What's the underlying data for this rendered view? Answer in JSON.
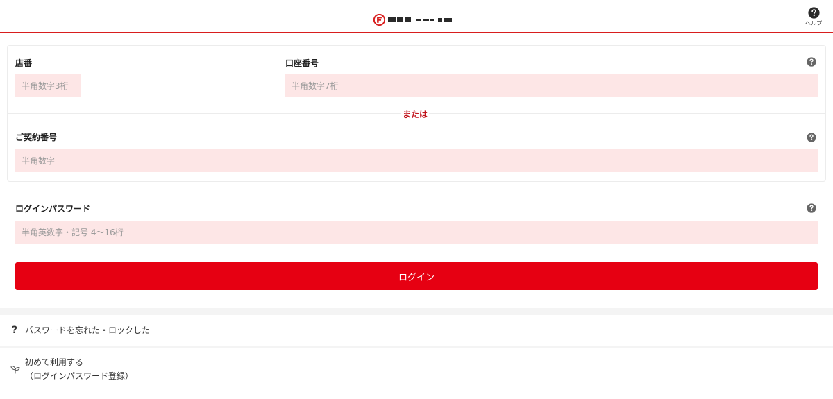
{
  "header": {
    "help_label": "ヘルプ",
    "logo_icon": "bank-logo-icon",
    "help_icon": "question-circle-icon",
    "accent_color": "#d81e1e"
  },
  "form": {
    "branch": {
      "label": "店番",
      "placeholder": "半角数字3桁"
    },
    "account": {
      "label": "口座番号",
      "placeholder": "半角数字7桁"
    },
    "or_text": "または",
    "contract": {
      "label": "ご契約番号",
      "placeholder": "半角数字"
    },
    "password": {
      "label": "ログインパスワード",
      "placeholder": "半角英数字・記号 4～16桁"
    },
    "login_button": "ログイン",
    "input_bg": "#fde6e6",
    "button_color": "#e60012"
  },
  "links": {
    "forgot": "パスワードを忘れた・ロックした",
    "first_time_line1": "初めて利用する",
    "first_time_line2": "（ログインパスワード登録）",
    "forgot_icon": "question-mark-icon",
    "first_time_icon": "sprout-icon"
  }
}
